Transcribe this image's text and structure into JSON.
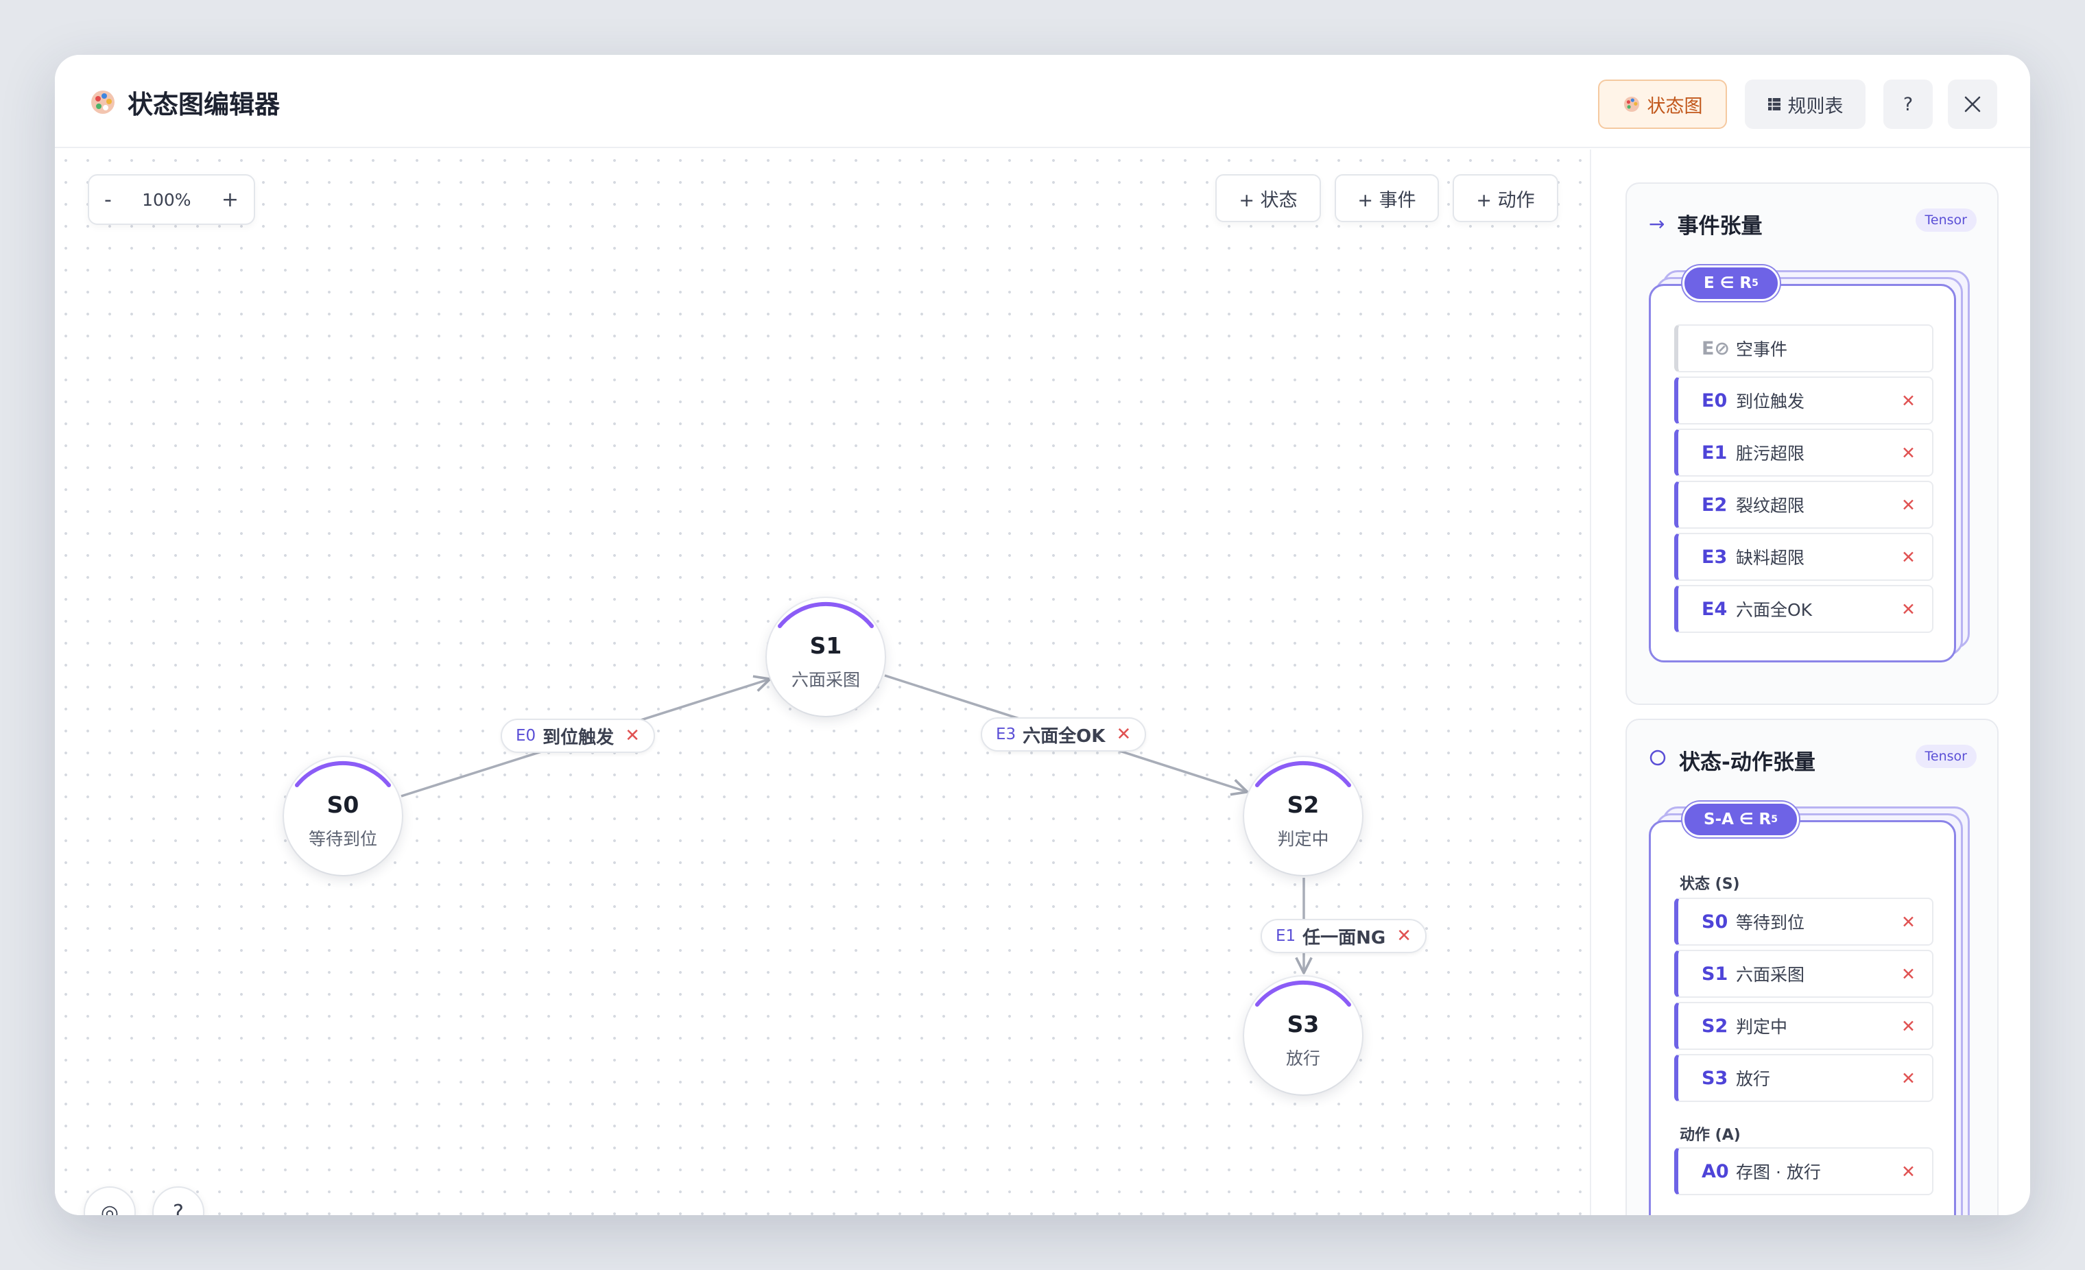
{
  "app": {
    "title": "状态图编辑器",
    "icon": "palette-icon"
  },
  "header": {
    "tab_diagram": "状态图",
    "tab_rules": "规则表",
    "help": "?",
    "close_icon": "close-icon"
  },
  "canvas": {
    "zoom_minus": "-",
    "zoom_level": "100%",
    "zoom_plus": "+",
    "add_state": "+ 状态",
    "add_event": "+ 事件",
    "add_action": "+ 动作",
    "locate": "◎",
    "help": "?"
  },
  "nodes": [
    {
      "id": "S0",
      "label": "等待到位"
    },
    {
      "id": "S1",
      "label": "六面采图"
    },
    {
      "id": "S2",
      "label": "判定中"
    },
    {
      "id": "S3",
      "label": "放行"
    }
  ],
  "edges": [
    {
      "event": "E0",
      "label": "到位触发",
      "remove": "✕"
    },
    {
      "event": "E3",
      "label": "六面全OK",
      "remove": "✕"
    },
    {
      "event": "E1",
      "label": "任一面NG",
      "remove": "✕"
    }
  ],
  "event_panel": {
    "title": "事件张量",
    "badge": "Tensor",
    "pill": "E ∈ R",
    "pill_sup": "5",
    "items": [
      {
        "id": "E⊘",
        "label": "空事件"
      },
      {
        "id": "E0",
        "label": "到位触发",
        "remove": "✕"
      },
      {
        "id": "E1",
        "label": "脏污超限",
        "remove": "✕"
      },
      {
        "id": "E2",
        "label": "裂纹超限",
        "remove": "✕"
      },
      {
        "id": "E3",
        "label": "缺料超限",
        "remove": "✕"
      },
      {
        "id": "E4",
        "label": "六面全OK",
        "remove": "✕"
      }
    ]
  },
  "sa_panel": {
    "title": "状态-动作张量",
    "badge": "Tensor",
    "pill": "S-A ∈ R",
    "pill_sup": "5",
    "states_label": "状态 (S)",
    "states": [
      {
        "id": "S0",
        "label": "等待到位",
        "remove": "✕"
      },
      {
        "id": "S1",
        "label": "六面采图",
        "remove": "✕"
      },
      {
        "id": "S2",
        "label": "判定中",
        "remove": "✕"
      },
      {
        "id": "S3",
        "label": "放行",
        "remove": "✕"
      }
    ],
    "actions_label": "动作 (A)",
    "actions": [
      {
        "id": "A0",
        "label": "存图 · 放行",
        "remove": "✕"
      }
    ]
  },
  "colors": {
    "accent": "#6e63e6",
    "arc": "#8b5cf6",
    "remove": "#e05252",
    "active_tab": "#c2581c"
  }
}
